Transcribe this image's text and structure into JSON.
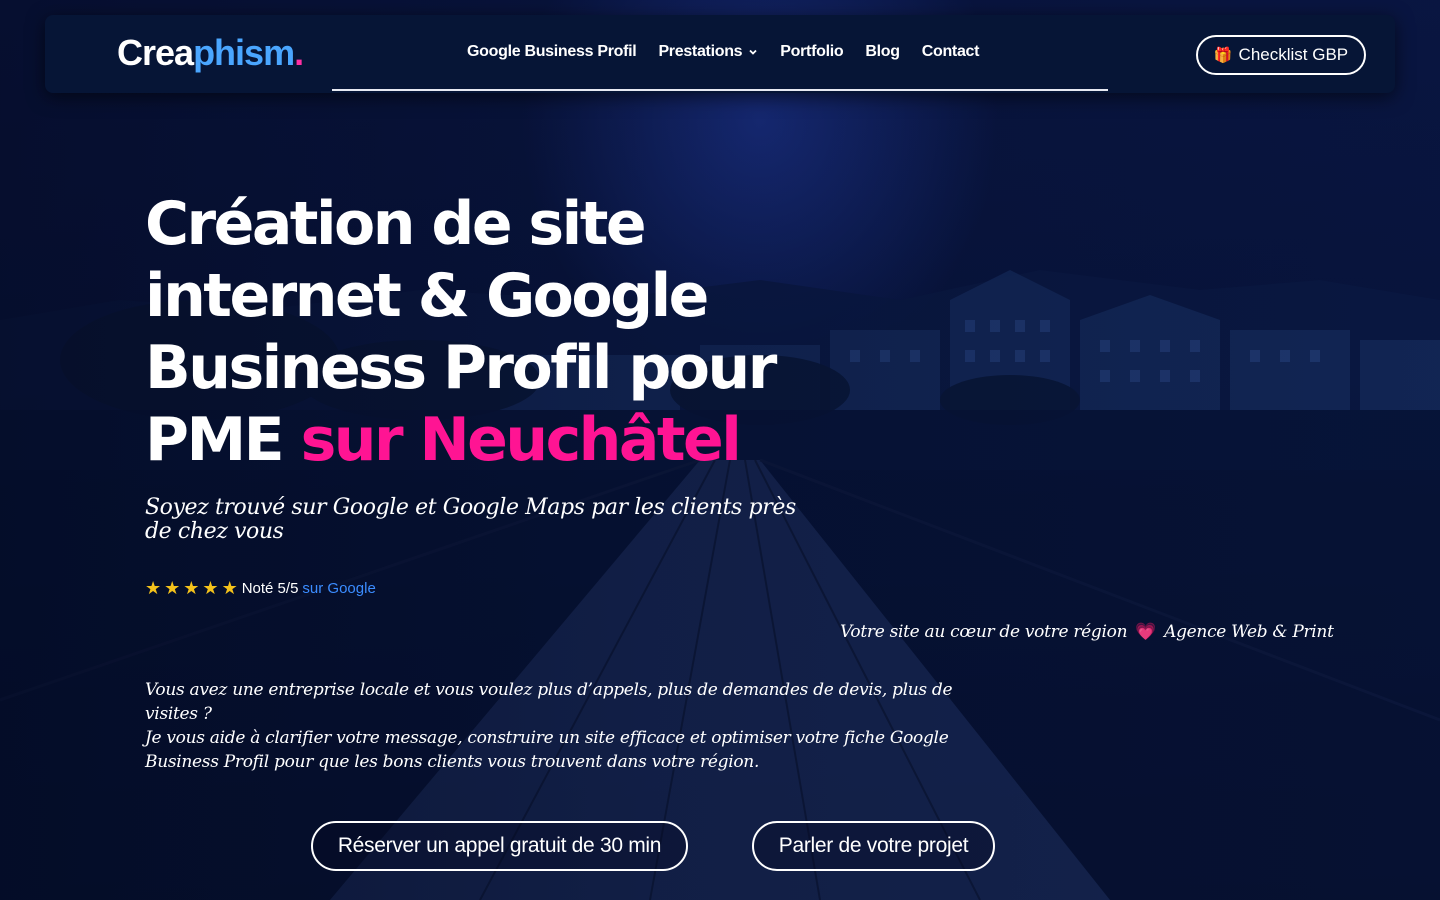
{
  "brand": {
    "logo_part1": "Crea",
    "logo_part2": "phism",
    "logo_dot": ".",
    "colors": {
      "primary_text": "#ffffff",
      "logo_blue": "#4aa6ff",
      "accent_pink": "#ff1493",
      "star_yellow": "#f4c21b",
      "link_blue": "#3b8cff"
    }
  },
  "nav": {
    "items": [
      {
        "label": "Google Business Profil"
      },
      {
        "label": "Prestations",
        "icon": "chevron-down-icon"
      },
      {
        "label": "Portfolio"
      },
      {
        "label": "Blog"
      },
      {
        "label": "Contact"
      }
    ]
  },
  "header_cta": {
    "label": "Checklist GBP",
    "icon": "gift-icon"
  },
  "hero": {
    "title_main": "Création de site internet & Google Business Profil pour PME ",
    "title_accent": "sur Neuchâtel",
    "subtitle": "Soyez trouvé sur Google et Google Maps par les clients près de chez vous",
    "rating": {
      "stars": 5,
      "text": "Noté 5/5",
      "link": "sur Google"
    },
    "tagline_left": "Votre site au cœur de votre région",
    "tagline_icon": "heart-icon",
    "tagline_right": "Agence Web & Print",
    "intro_line1": "Vous avez une entreprise locale et vous voulez plus d’appels, plus de demandes de devis, plus de visites ?",
    "intro_line2": "Je vous aide à clarifier votre message, construire un site efficace et optimiser votre fiche Google Business Profil pour que les bons clients vous trouvent dans votre région."
  },
  "buttons": {
    "call": "Réserver un appel gratuit de 30 min",
    "project": "Parler de votre projet"
  }
}
